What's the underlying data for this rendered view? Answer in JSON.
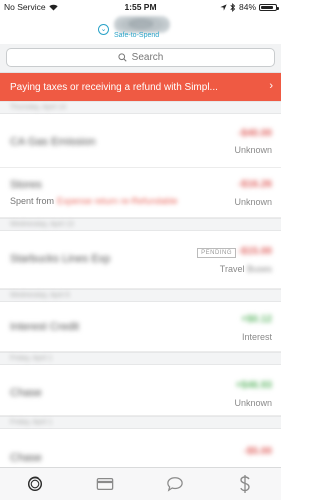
{
  "status_bar": {
    "carrier": "No Service",
    "time": "1:55 PM",
    "battery": "84%",
    "battery_level": 0.84
  },
  "header": {
    "logo_icon": "app-logo-icon",
    "safe_to_spend_label": "Safe-to-Spend",
    "toggle_icon": "chevron-down-icon"
  },
  "search": {
    "placeholder": "Search",
    "icon": "search-icon"
  },
  "banner": {
    "text": "Paying taxes or receiving a refund with Simpl...",
    "arrow": "›",
    "color": "#ef5a43"
  },
  "transactions": {
    "groups": [
      {
        "date": "Thursday, April 14",
        "items": [
          {
            "merchant": "CA Gas Emission",
            "amount": "-$40.00",
            "category": "Unknown",
            "spent_from": ""
          },
          {
            "merchant": "Stores",
            "amount": "-$16.26",
            "category": "Unknown",
            "spent_from_label": "Spent from",
            "spent_from": "Expense return re-Refundable"
          }
        ]
      },
      {
        "date": "Wednesday, April 13",
        "items": [
          {
            "merchant": "Starbucks Lines Exp",
            "amount": "-$15.00",
            "status": "PENDING",
            "category_prefix": "Travel",
            "category_suffix": "Buses"
          }
        ]
      },
      {
        "date": "Wednesday, April 6",
        "items": [
          {
            "merchant": "Interest Credit",
            "amount": "+$0.12",
            "category": "Interest"
          }
        ]
      },
      {
        "date": "Friday, April 1",
        "items": [
          {
            "merchant": "Chase",
            "amount": "+$46.93",
            "category": "Unknown"
          }
        ]
      },
      {
        "date": "Friday, April 1",
        "items": [
          {
            "merchant": "Chase",
            "amount": "-$5.00",
            "category": ""
          }
        ]
      }
    ]
  },
  "tab_bar": {
    "tabs": [
      {
        "name": "activity",
        "icon": "activity-ring-icon"
      },
      {
        "name": "cards",
        "icon": "card-icon"
      },
      {
        "name": "messages",
        "icon": "chat-bubble-icon"
      },
      {
        "name": "money",
        "icon": "dollar-icon"
      }
    ]
  },
  "colors": {
    "accent": "#2aa3c8",
    "negative": "#e0625f",
    "positive": "#63b86a"
  }
}
